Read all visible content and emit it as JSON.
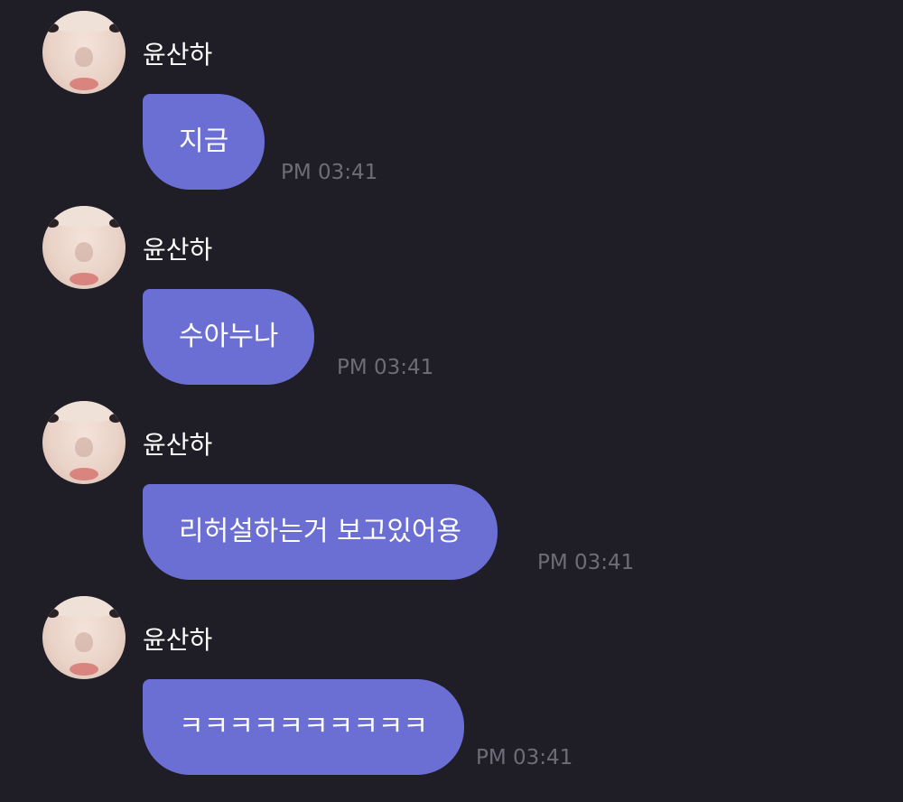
{
  "messages": [
    {
      "sender": "윤산하",
      "avatar_icon": "profile-photo-icon",
      "text": "지금",
      "time": "PM 03:41"
    },
    {
      "sender": "윤산하",
      "avatar_icon": "profile-photo-icon",
      "text": "수아누나",
      "time": "PM 03:41"
    },
    {
      "sender": "윤산하",
      "avatar_icon": "profile-photo-icon",
      "text": "리허설하는거 보고있어용",
      "time": "PM 03:41"
    },
    {
      "sender": "윤산하",
      "avatar_icon": "profile-photo-icon",
      "text": "ㅋㅋㅋㅋㅋㅋㅋㅋㅋㅋ",
      "time": "PM 03:41"
    }
  ],
  "colors": {
    "background": "#1f1e26",
    "bubble": "#6b6fd4",
    "timestamp": "#6d6c78",
    "text": "#ffffff"
  }
}
